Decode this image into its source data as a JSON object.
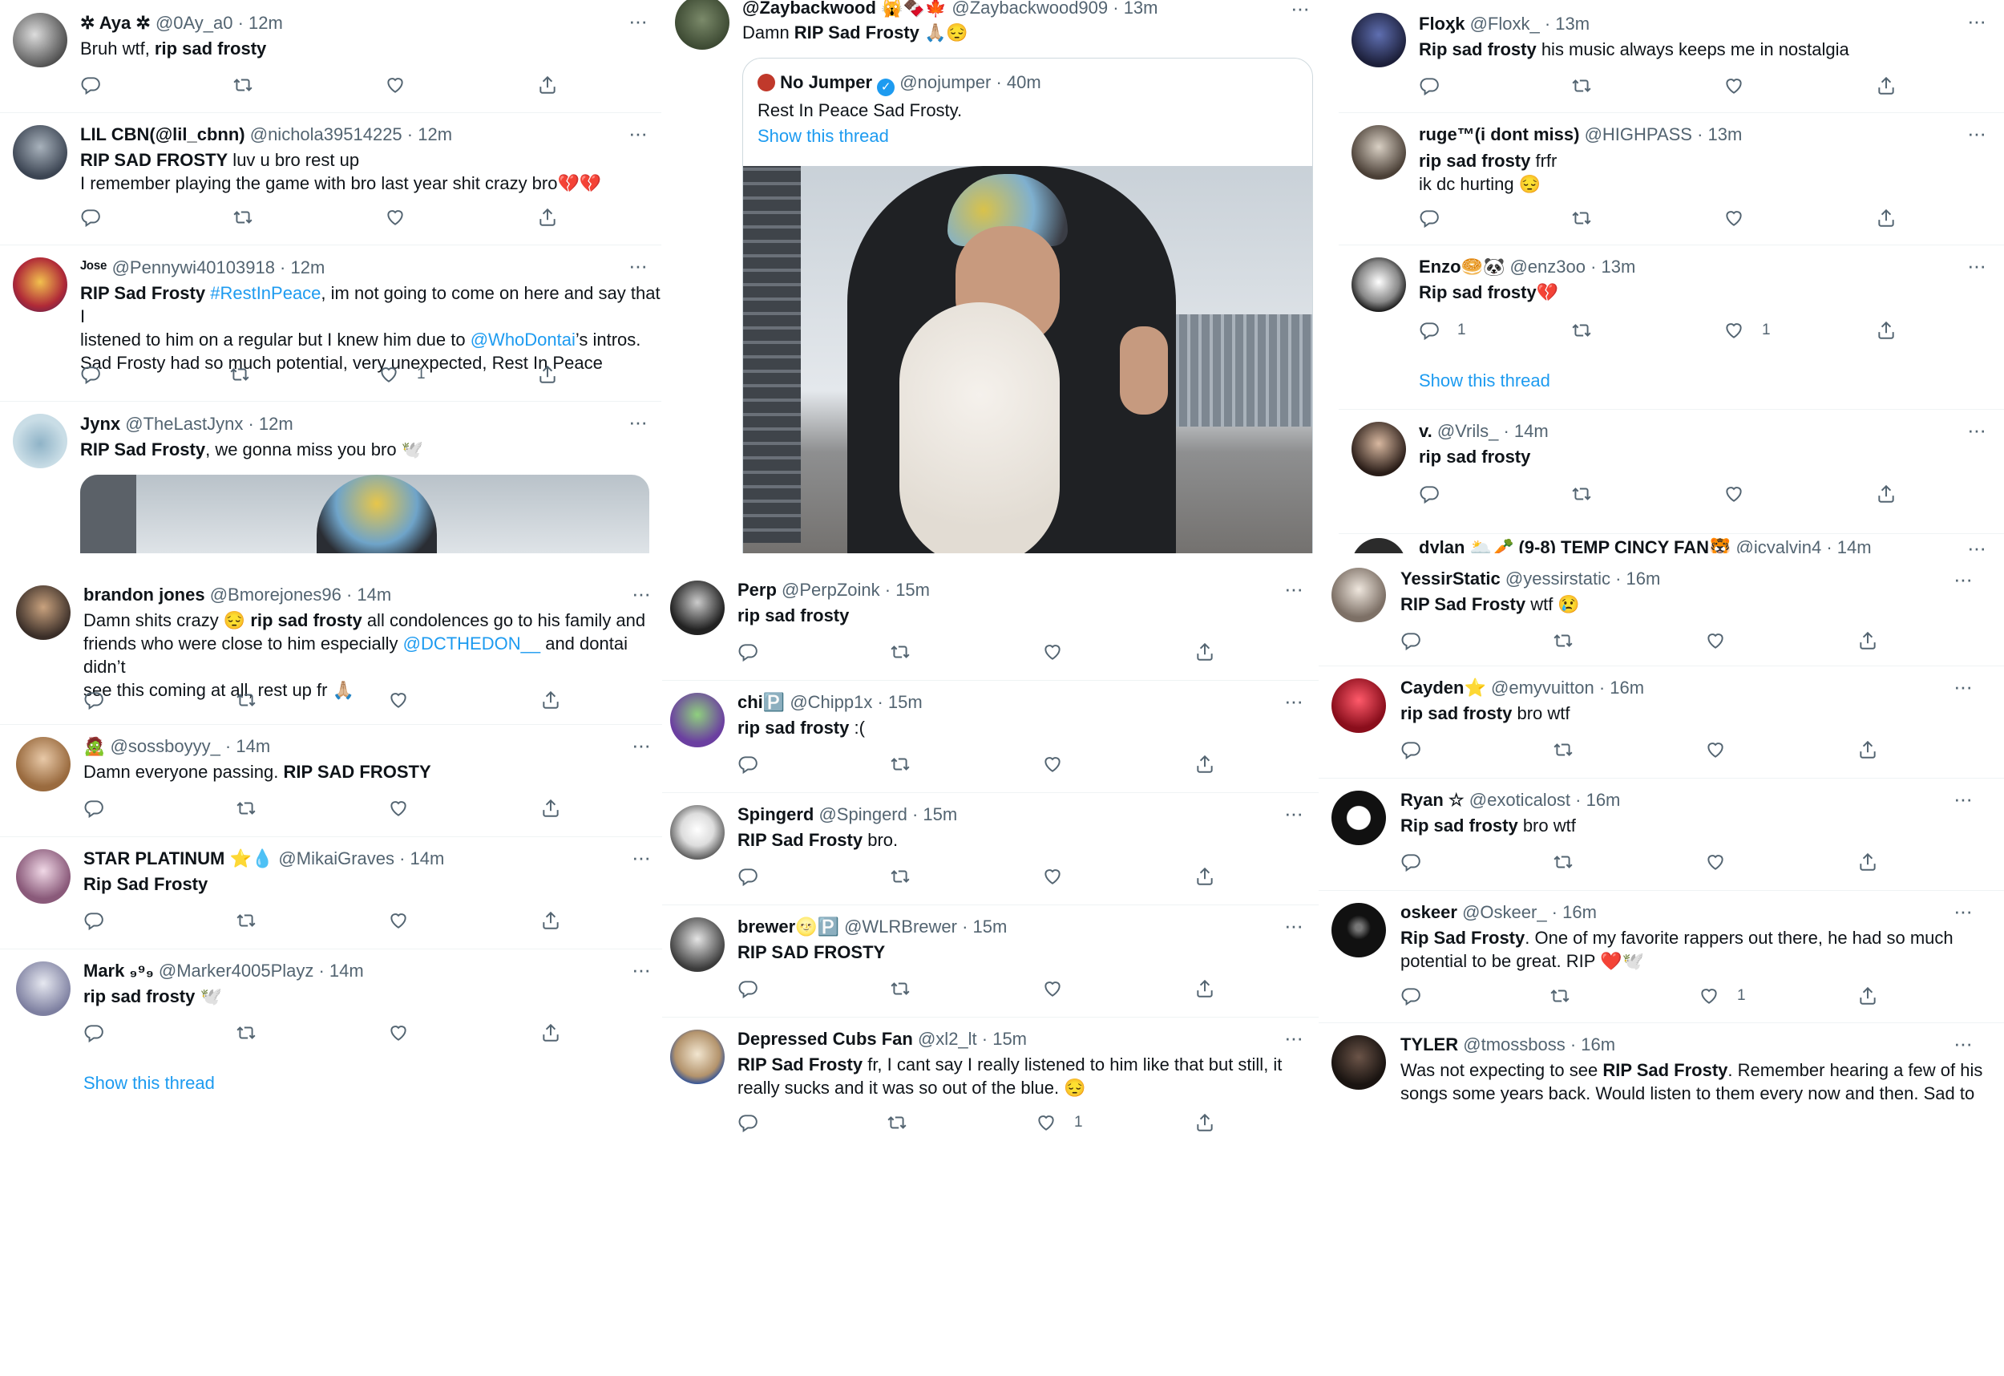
{
  "colors": {
    "link": "#1d9bf0",
    "muted": "#536471",
    "text": "#0f1419",
    "divider": "#eff3f4",
    "heart": "#e0245e"
  },
  "icons": {
    "reply": "reply-icon",
    "retweet": "retweet-icon",
    "like": "heart-icon",
    "share": "share-icon",
    "more": "more-icon"
  },
  "col1": [
    {
      "name": "✲ Aya ✲",
      "handle": "@0Ay_a0 · 12m",
      "line1a": "Bruh wtf, ",
      "line1b": "rip sad frosty"
    },
    {
      "name": "LIL CBN(@lil_cbnn)",
      "handle": "@nichola39514225 · 12m",
      "line1a": "RIP SAD FROSTY",
      "line1b": " luv u bro rest up",
      "line2": "I remember playing the game with bro last year shit crazy bro💔💔"
    },
    {
      "name": "ᴶᵒˢᵉ",
      "handle": "@Pennywi40103918 · 12m",
      "line1a": "RIP Sad Frosty",
      "line1b": " ",
      "line1c": "#RestInPeace",
      "line1d": ", im not going to come on here and say that I",
      "line2a": "listened to him on a regular but I knew him due to ",
      "line2b": "@WhoDontai",
      "line2c": "’s intros.",
      "line3": "Sad Frosty had so much potential, very unexpected, Rest In Peace",
      "likes": "1"
    },
    {
      "name": "Jynx",
      "handle": "@TheLastJynx · 12m",
      "line1a": "RIP Sad Frosty",
      "line1b": ", we gonna miss you bro 🕊️"
    }
  ],
  "col2_top": {
    "name": "@Zaybackwood 🙀🍫🍁",
    "handle": "@Zaybackwood909 · 13m",
    "line1a": "Damn ",
    "line1b": "RIP Sad Frosty",
    "line1c": " 🙏🏼😔",
    "quote": {
      "name": "No Jumper",
      "handle": "@nojumper · 40m",
      "text": "Rest In Peace Sad Frosty.",
      "thread": "Show this thread"
    }
  },
  "col3_top": [
    {
      "name": "Floӽk",
      "handle": "@Floxk_ · 13m",
      "line1a": "Rip sad frosty",
      "line1b": " his music always keeps me in nostalgia"
    },
    {
      "name": "ruge™(i dont miss)",
      "handle": "@HIGHPASS · 13m",
      "line1a": "rip sad frosty",
      "line1b": " frfr",
      "line2": "ik dc hurting 😔"
    },
    {
      "name": "Enzo🥯🐼",
      "handle": "@enz3oo · 13m",
      "line1a": "Rip sad frosty",
      "line1b": "💔",
      "replies": "1",
      "likes": "1",
      "thread": "Show this thread"
    },
    {
      "name": "v.",
      "handle": "@Vrils_ · 14m",
      "line1a": "rip sad frosty"
    },
    {
      "name": "dylan 🌥️🥕 (9-8) TEMP CINCY FAN🐯",
      "handle": "@icyalvin4 · 14m"
    }
  ],
  "col1_bottom": [
    {
      "name": "brandon jones",
      "handle": "@Bmorejones96 · 14m",
      "line1a": "Damn shits crazy 😔 ",
      "line1b": "rip sad frosty",
      "line1c": " all condolences go to his family and",
      "line2a": "friends who were close to him especially ",
      "line2b": "@DCTHEDON__",
      "line2c": " and dontai didn’t",
      "line3": "see this coming at all, rest up fr 🙏🏼"
    },
    {
      "name": "🧟",
      "handle": "@sossboyyy_ · 14m",
      "line1a": "Damn everyone passing. ",
      "line1b": "RIP SAD FROSTY"
    },
    {
      "name": "STAR PLATINUM ⭐💧",
      "handle": "@MikaiGraves · 14m",
      "line1a": "Rip Sad Frosty"
    },
    {
      "name": "Mark ₉⁹₉",
      "handle": "@Marker4005Playz · 14m",
      "line1a": "rip sad frosty",
      "line1b": " 🕊️",
      "thread": "Show this thread"
    }
  ],
  "col2_bottom": [
    {
      "name": "Perp",
      "handle": "@PerpZoink · 15m",
      "line1a": "rip sad frosty"
    },
    {
      "name": "chi🅿️",
      "handle": "@Chipp1x · 15m",
      "line1a": "rip sad frosty",
      "line1b": " :("
    },
    {
      "name": "Spingerd",
      "handle": "@Spingerd · 15m",
      "line1a": "RIP Sad Frosty",
      "line1b": " bro."
    },
    {
      "name": "brewer🌝🅿️",
      "handle": "@WLRBrewer · 15m",
      "line1a": "RIP SAD FROSTY"
    },
    {
      "name": "Depressed Cubs Fan",
      "handle": "@xl2_lt · 15m",
      "line1a": "RIP Sad Frosty",
      "line1b": " fr, I cant say I really listened to him like that but still, it",
      "line2": "really sucks and it was so out of the blue. 😔",
      "likes": "1"
    }
  ],
  "col3_bottom": [
    {
      "name": "YessirStatic",
      "handle": "@yessirstatic · 16m",
      "line1a": "RIP Sad Frosty",
      "line1b": " wtf 😢"
    },
    {
      "name": "Cayden⭐",
      "handle": "@emyvuitton · 16m",
      "line1a": "rip sad frosty",
      "line1b": " bro wtf"
    },
    {
      "name": "Ryan ☆",
      "handle": "@exoticalost · 16m",
      "line1a": "Rip sad frosty",
      "line1b": " bro wtf"
    },
    {
      "name": "oskeer",
      "handle": "@Oskeer_ · 16m",
      "line1a": "Rip Sad Frosty",
      "line1b": ". One of my favorite rappers out there, he had so much",
      "line2": "potential to be great. RIP ❤️🕊️",
      "likes": "1"
    },
    {
      "name": "TYLER",
      "handle": "@tmossboss · 16m",
      "line1a": "Was not expecting to see ",
      "line1b": "RIP Sad Frosty",
      "line1c": ". Remember hearing a few of his",
      "line2": "songs some years back. Would listen to them every now and then. Sad to"
    }
  ]
}
